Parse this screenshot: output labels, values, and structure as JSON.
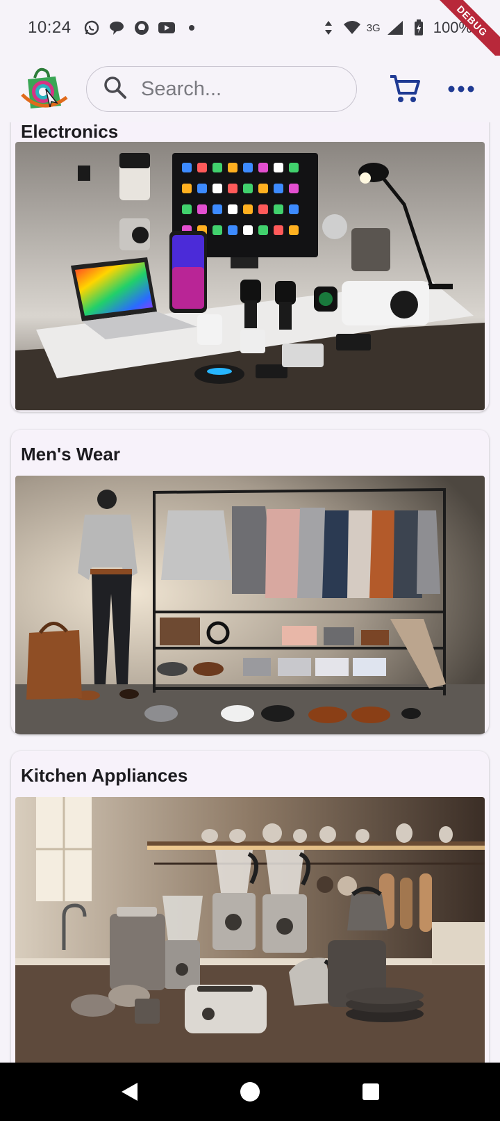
{
  "status_bar": {
    "time": "10:24",
    "network": "3G",
    "battery": "100%",
    "notification_icons": [
      "whatsapp-icon",
      "chat-icon",
      "github-icon",
      "youtube-icon",
      "dot-icon"
    ]
  },
  "debug_banner": "DEBUG",
  "app_bar": {
    "search_placeholder": "Search...",
    "icons": [
      "app-logo",
      "search-icon",
      "shopping-cart-icon",
      "more-horizontal-icon"
    ]
  },
  "categories": [
    {
      "title": "Electronics",
      "image": "electronics-image"
    },
    {
      "title": "Men's Wear",
      "image": "mens-wear-image"
    },
    {
      "title": "Kitchen Appliances",
      "image": "kitchen-appliances-image"
    }
  ],
  "nav_bar": {
    "icons": [
      "back-icon",
      "home-icon",
      "recents-icon"
    ]
  },
  "colors": {
    "accent": "#1f3a93",
    "background": "#f6f3f9",
    "debug": "#b8283a"
  }
}
